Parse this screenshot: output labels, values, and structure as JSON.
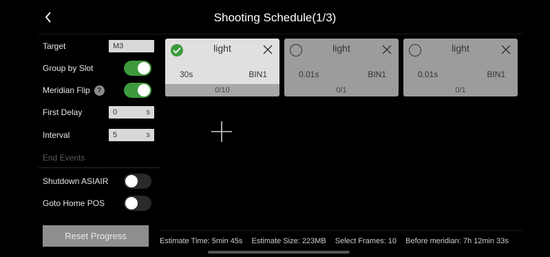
{
  "header": {
    "title": "Shooting Schedule(1/3)",
    "back_icon": "chevron-left-icon"
  },
  "sidebar": {
    "target": {
      "label": "Target",
      "value": "M3"
    },
    "group_by_slot": {
      "label": "Group by Slot",
      "on": true
    },
    "meridian_flip": {
      "label": "Meridian Flip",
      "help": "?",
      "on": true
    },
    "first_delay": {
      "label": "First Delay",
      "value": "0",
      "unit": "s"
    },
    "interval": {
      "label": "Interval",
      "value": "5",
      "unit": "s"
    },
    "end_events": {
      "label": "End Events"
    },
    "shutdown": {
      "label": "Shutdown ASIAIR",
      "on": false
    },
    "goto_home": {
      "label": "Goto Home POS",
      "on": false
    },
    "reset_label": "Reset Progress"
  },
  "cards": [
    {
      "type": "light",
      "exposure": "30s",
      "bin": "BIN1",
      "progress": "0/10",
      "selected": true
    },
    {
      "type": "light",
      "exposure": "0.01s",
      "bin": "BIN1",
      "progress": "0/1",
      "selected": false
    },
    {
      "type": "light",
      "exposure": "0.01s",
      "bin": "BIN1",
      "progress": "0/1",
      "selected": false
    }
  ],
  "status": {
    "estimate_time": "Estimate Time: 5min 45s",
    "estimate_size": "Estimate Size: 223MB",
    "select_frames": "Select Frames: 10",
    "before_meridian": "Before meridian: 7h 12min 33s"
  },
  "colors": {
    "toggle_on": "#3d9a3d",
    "card_selected": "#e0e0e0",
    "card_default": "#9c9c9c"
  }
}
